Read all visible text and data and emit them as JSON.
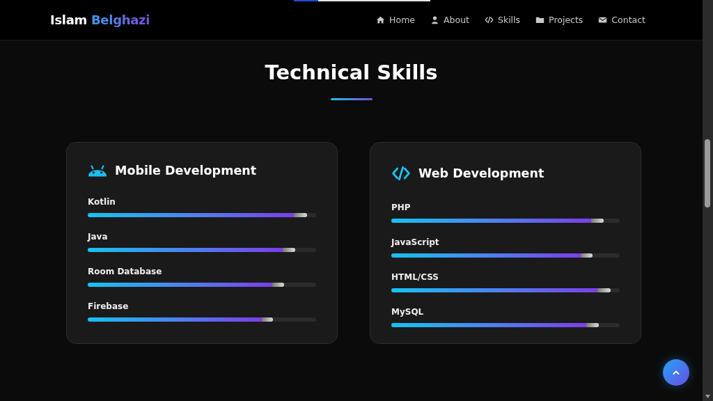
{
  "scroll_progress": {
    "level": 0.18
  },
  "brand": {
    "first": "Islam",
    "second": "Belghazi"
  },
  "nav": [
    {
      "label": "Home",
      "kind": "home"
    },
    {
      "label": "About",
      "kind": "user"
    },
    {
      "label": "Skills",
      "kind": "code"
    },
    {
      "label": "Projects",
      "kind": "folder"
    },
    {
      "label": "Contact",
      "kind": "mail"
    }
  ],
  "section": {
    "title": "Technical Skills"
  },
  "cards": [
    {
      "title": "Mobile Development",
      "kind": "android",
      "skills": [
        {
          "name": "Kotlin",
          "level": 0.96
        },
        {
          "name": "Java",
          "level": 0.91
        },
        {
          "name": "Room Database",
          "level": 0.86
        },
        {
          "name": "Firebase",
          "level": 0.81
        }
      ]
    },
    {
      "title": "Web Development",
      "kind": "code",
      "skills": [
        {
          "name": "PHP",
          "level": 0.93
        },
        {
          "name": "JavaScript",
          "level": 0.88
        },
        {
          "name": "HTML/CSS",
          "level": 0.96
        },
        {
          "name": "MySQL",
          "level": 0.91
        }
      ]
    }
  ]
}
